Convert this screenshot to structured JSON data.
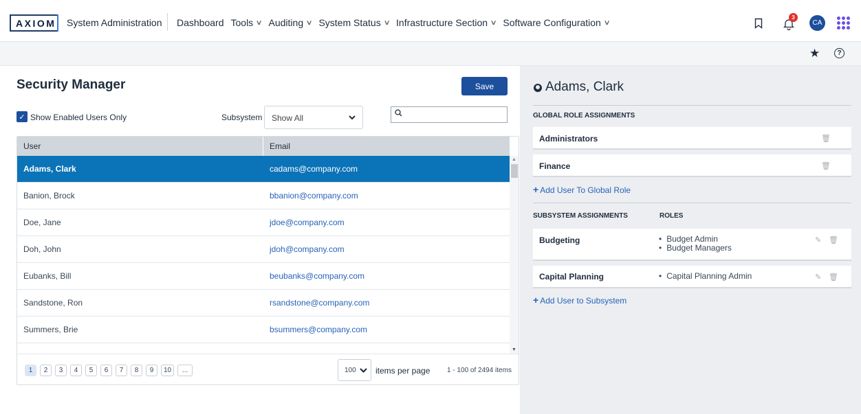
{
  "header": {
    "logo_text": "AXIOM",
    "app_title": "System Administration",
    "nav_items": [
      {
        "label": "Dashboard",
        "has_dropdown": false
      },
      {
        "label": "Tools",
        "has_dropdown": true
      },
      {
        "label": "Auditing",
        "has_dropdown": true
      },
      {
        "label": "System Status",
        "has_dropdown": true
      },
      {
        "label": "Infrastructure Section",
        "has_dropdown": true
      },
      {
        "label": "Software Configuration",
        "has_dropdown": true
      }
    ],
    "notification_count": "3",
    "avatar_initials": "CA",
    "icons": [
      "bookmark-icon",
      "bell-icon",
      "apps-grid-icon",
      "star-icon",
      "help-icon"
    ]
  },
  "security": {
    "title": "Security Manager",
    "save_label": "Save",
    "show_enabled_label": "Show Enabled Users Only",
    "show_enabled_checked": true,
    "subsystem_label": "Subsystem",
    "subsystem_value": "Show All",
    "search_value": "",
    "columns": {
      "user": "User",
      "email": "Email"
    },
    "rows": [
      {
        "user": "Adams, Clark",
        "email": "cadams@company.com",
        "selected": true
      },
      {
        "user": "Banion, Brock",
        "email": "bbanion@company.com",
        "selected": false
      },
      {
        "user": "Doe, Jane",
        "email": "jdoe@company.com",
        "selected": false
      },
      {
        "user": "Doh, John",
        "email": "jdoh@company.com",
        "selected": false
      },
      {
        "user": "Eubanks, Bill",
        "email": "beubanks@company.com",
        "selected": false
      },
      {
        "user": "Sandstone, Ron",
        "email": "rsandstone@company.com",
        "selected": false
      },
      {
        "user": "Summers, Brie",
        "email": "bsummers@company.com",
        "selected": false
      }
    ],
    "pagination": {
      "pages": [
        "1",
        "2",
        "3",
        "4",
        "5",
        "6",
        "7",
        "8",
        "9",
        "10",
        "..."
      ],
      "active_page": "1",
      "per_page_value": "100",
      "per_page_label": "items per page",
      "range_label": "1 - 100 of 2494 items"
    }
  },
  "details": {
    "user_name": "Adams, Clark",
    "global_title": "GLOBAL ROLE ASSIGNMENTS",
    "global_roles": [
      "Administrators",
      "Finance"
    ],
    "add_global_label": "Add User To Global Role",
    "subsystem_title": "SUBSYSTEM ASSIGNMENTS",
    "roles_title": "ROLES",
    "subsystems": [
      {
        "name": "Budgeting",
        "roles": [
          "Budget Admin",
          "Budget Managers"
        ]
      },
      {
        "name": "Capital Planning",
        "roles": [
          "Capital Planning Admin"
        ]
      }
    ],
    "add_subsystem_label": "Add User to Subsystem"
  },
  "colors": {
    "primary": "#1c4f9c",
    "selected_row": "#0b73b8",
    "link": "#2763b8",
    "badge": "#e0332b",
    "apps": "#6b4ee6",
    "right_panel_bg": "#eceef1"
  }
}
